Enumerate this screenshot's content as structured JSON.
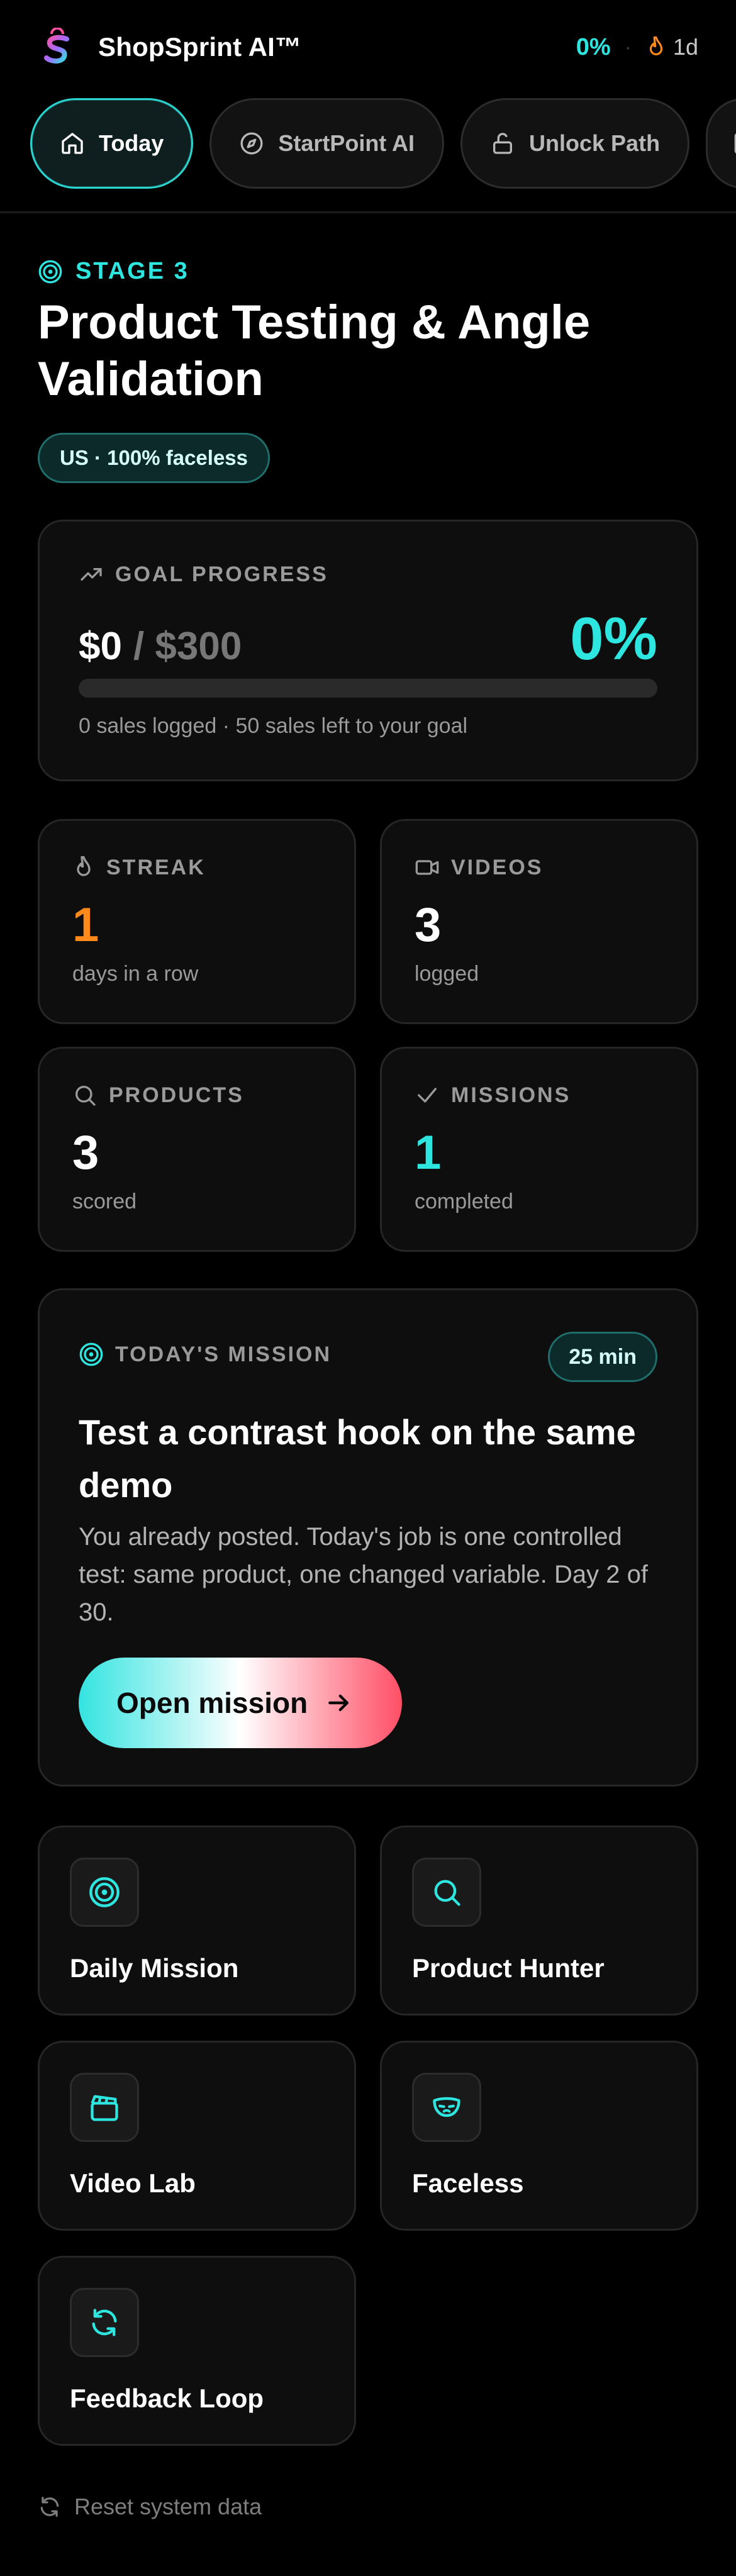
{
  "header": {
    "app_title": "ShopSprint AI™",
    "progress_pct": "0%",
    "separator": "·",
    "streak": "1d"
  },
  "tabs": [
    {
      "label": "Today",
      "icon": "home-icon",
      "active": true
    },
    {
      "label": "StartPoint AI",
      "icon": "compass-icon",
      "active": false
    },
    {
      "label": "Unlock Path",
      "icon": "unlock-icon",
      "active": false
    }
  ],
  "stage": {
    "label": "STAGE 3",
    "title": "Product Testing & Angle Validation",
    "pill": "US · 100% faceless"
  },
  "goal": {
    "label": "GOAL PROGRESS",
    "amount": "$0",
    "target": "/ $300",
    "pct": "0%",
    "progress": 0,
    "note": "0 sales logged · 50 sales left to your goal"
  },
  "stats": [
    {
      "label": "STREAK",
      "value": "1",
      "sub": "days in a row",
      "color": "#ff8a1c"
    },
    {
      "label": "VIDEOS",
      "value": "3",
      "sub": "logged",
      "color": "#ffffff"
    },
    {
      "label": "PRODUCTS",
      "value": "3",
      "sub": "scored",
      "color": "#ffffff"
    },
    {
      "label": "MISSIONS",
      "value": "1",
      "sub": "completed",
      "color": "#2ee6e0"
    }
  ],
  "mission": {
    "label": "TODAY'S MISSION",
    "duration": "25 min",
    "title": "Test a contrast hook on the same demo",
    "description": "You already posted. Today's job is one controlled test: same product, one changed variable. Day 2 of 30.",
    "cta": "Open mission"
  },
  "tools": [
    {
      "label": "Daily Mission",
      "icon": "target-icon"
    },
    {
      "label": "Product Hunter",
      "icon": "search-icon"
    },
    {
      "label": "Video Lab",
      "icon": "clapperboard-icon"
    },
    {
      "label": "Faceless",
      "icon": "mask-icon"
    },
    {
      "label": "Feedback Loop",
      "icon": "refresh-icon"
    }
  ],
  "footer": {
    "reset_label": "Reset system data"
  },
  "colors": {
    "accent": "#2ee6e0",
    "streak": "#ff8a1c",
    "background": "#000000",
    "card": "#0e0e0e"
  }
}
